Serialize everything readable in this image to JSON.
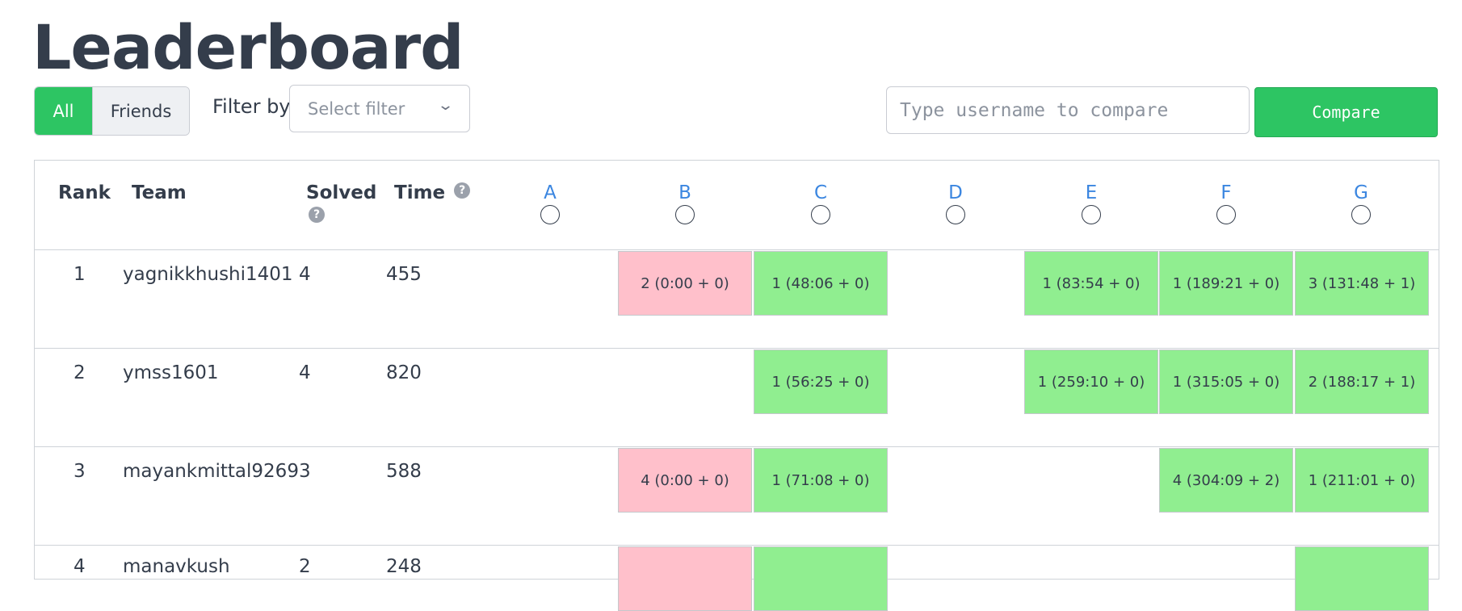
{
  "page": {
    "title": "Leaderboard"
  },
  "toolbar": {
    "all_label": "All",
    "friends_label": "Friends",
    "filter_label": "Filter by",
    "filter_placeholder": "Select filter",
    "compare_placeholder": "Type username to compare",
    "compare_button": "Compare"
  },
  "table": {
    "headers": {
      "rank": "Rank",
      "team": "Team",
      "solved": "Solved",
      "time": "Time",
      "help": "?"
    },
    "problems": [
      "A",
      "B",
      "C",
      "D",
      "E",
      "F",
      "G"
    ],
    "rows": [
      {
        "rank": "1",
        "team": "yagnikkhushi1401",
        "solved": "4",
        "time": "455",
        "cells": {
          "B": "2 (0:00 + 0)",
          "C": "1 (48:06 + 0)",
          "E": "1 (83:54 + 0)",
          "F": "1 (189:21 + 0)",
          "G": "3 (131:48 + 1)"
        }
      },
      {
        "rank": "2",
        "team": "ymss1601",
        "solved": "4",
        "time": "820",
        "cells": {
          "C": "1 (56:25 + 0)",
          "E": "1 (259:10 + 0)",
          "F": "1 (315:05 + 0)",
          "G": "2 (188:17 + 1)"
        }
      },
      {
        "rank": "3",
        "team": "mayankmittal9269",
        "solved": "3",
        "time": "588",
        "cells": {
          "B": "4 (0:00 + 0)",
          "C": "1 (71:08 + 0)",
          "F": "4 (304:09 + 2)",
          "G": "1 (211:01 + 0)"
        }
      },
      {
        "rank": "4",
        "team": "manavkush",
        "solved": "2",
        "time": "248",
        "cells": {
          "B": "",
          "C": "",
          "G": ""
        }
      }
    ]
  },
  "colors": {
    "accent": "#2dc563",
    "solved_cell": "#90ee90",
    "failed_cell": "#ffc0cb",
    "problem_link": "#3b86e0"
  }
}
